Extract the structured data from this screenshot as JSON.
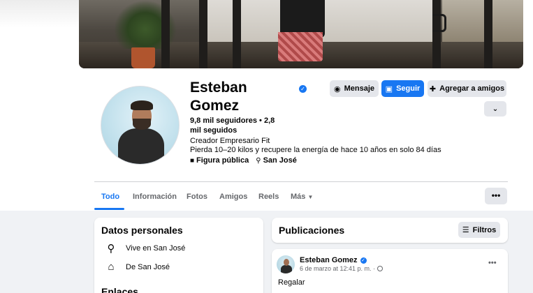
{
  "profile": {
    "name": "Esteban Gomez",
    "followers": "9,8 mil seguidores • 2,8 mil seguidos",
    "category": "Creador Empresario Fit",
    "bio": "Pierda 10–20 kilos y recupere la energía de hace 10 años en solo 84 días",
    "page_type": "Figura pública",
    "location": "San José"
  },
  "actions": {
    "message": "Mensaje",
    "follow": "Seguir",
    "add_friend": "Agregar a amigos",
    "more_icon": "chevron-down-icon"
  },
  "tabs": [
    {
      "label": "Todo",
      "active": true
    },
    {
      "label": "Información"
    },
    {
      "label": "Fotos"
    },
    {
      "label": "Amigos"
    },
    {
      "label": "Reels"
    },
    {
      "label": "Más"
    }
  ],
  "tabs_more_label": "•••",
  "intro": {
    "title": "Datos personales",
    "lives_in": "Vive en San José",
    "from": "De San José",
    "links_title": "Enlaces"
  },
  "posts": {
    "title": "Publicaciones",
    "filter_label": "Filtros",
    "first_post": {
      "author": "Esteban Gomez",
      "date": "6 de marzo at 12:41 p. m. ·",
      "text": "Regalar",
      "options_label": "•••"
    }
  },
  "colors": {
    "accent": "#1877f2",
    "background": "#f0f2f5",
    "button_grey": "#e4e6eb"
  }
}
